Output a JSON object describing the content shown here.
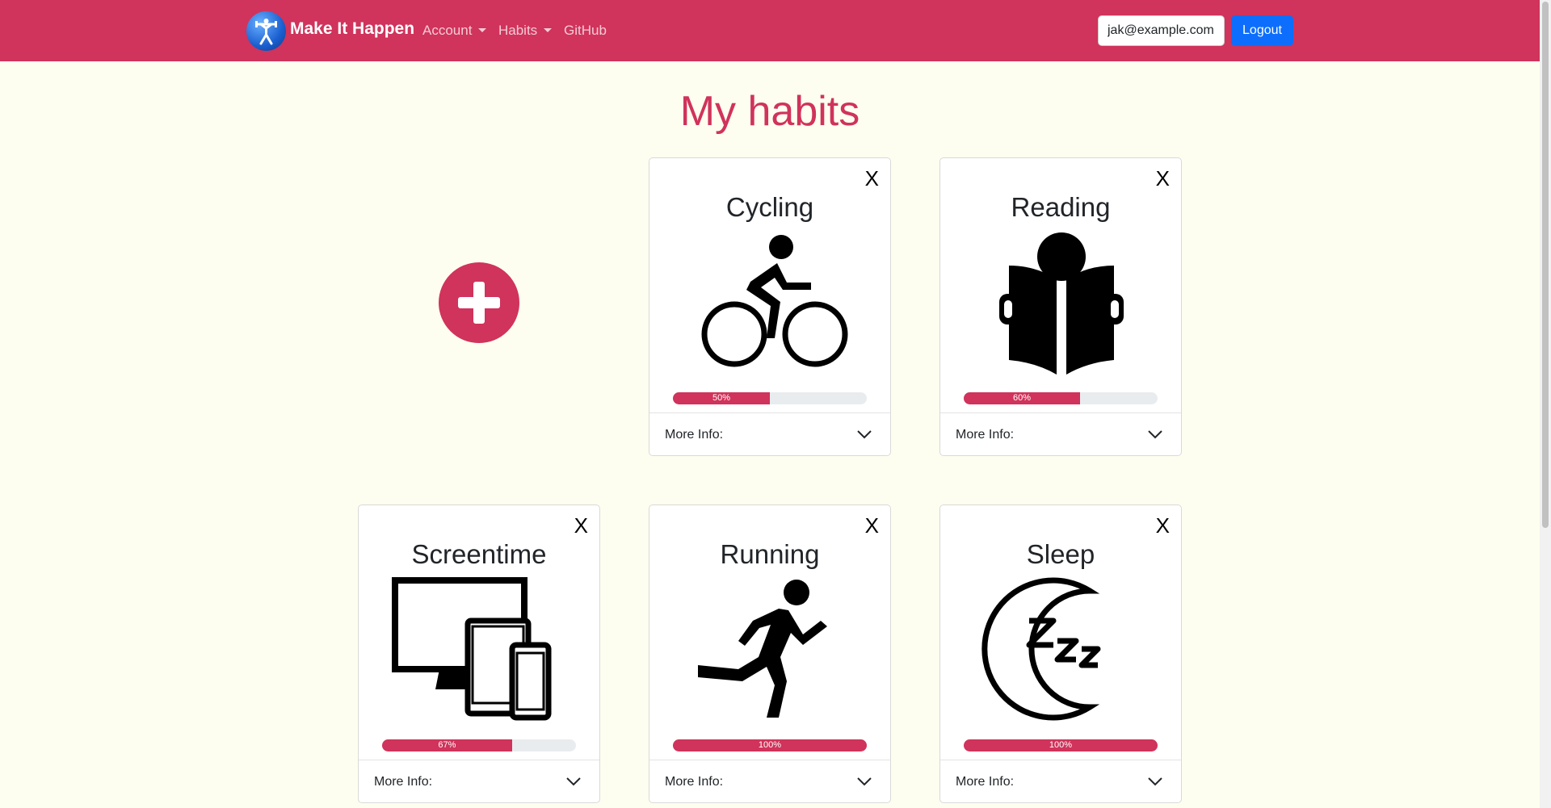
{
  "navbar": {
    "brand": "Make It Happen",
    "menu": [
      {
        "label": "Account",
        "dropdown": true
      },
      {
        "label": "Habits",
        "dropdown": true
      },
      {
        "label": "GitHub",
        "dropdown": false
      }
    ],
    "email_value": "jak@example.com",
    "logout_label": "Logout"
  },
  "page": {
    "title": "My habits"
  },
  "add_icon": "plus-circle-icon",
  "more_info_label": "More Info:",
  "close_label": "X",
  "habits": [
    {
      "title": "Cycling",
      "icon": "cycling-icon",
      "progress": 50,
      "progress_label": "50%"
    },
    {
      "title": "Reading",
      "icon": "reading-icon",
      "progress": 60,
      "progress_label": "60%"
    },
    {
      "title": "Screentime",
      "icon": "devices-icon",
      "progress": 67,
      "progress_label": "67%"
    },
    {
      "title": "Running",
      "icon": "running-icon",
      "progress": 100,
      "progress_label": "100%"
    },
    {
      "title": "Sleep",
      "icon": "sleep-icon",
      "progress": 100,
      "progress_label": "100%"
    }
  ],
  "colors": {
    "accent": "#d0335b",
    "background": "#fefef0",
    "primary_button": "#0d6efd"
  }
}
